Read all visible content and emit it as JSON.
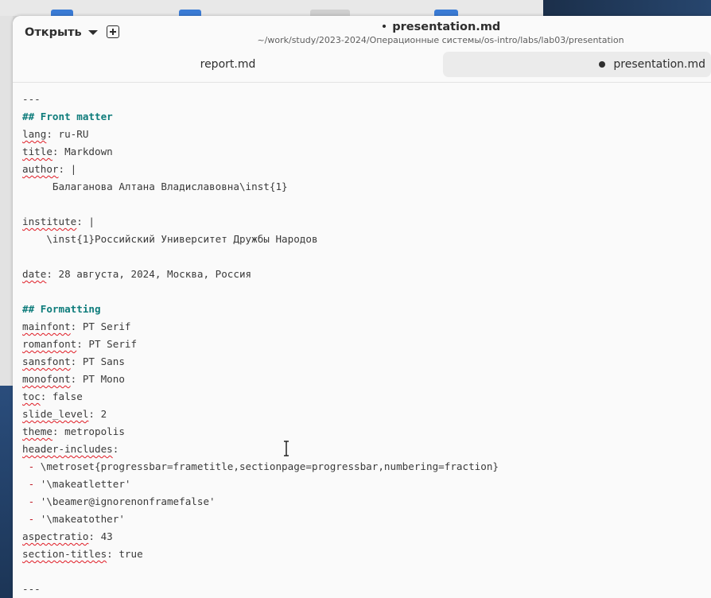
{
  "window": {
    "title": "presentation.md",
    "modified_marker": "•",
    "subtitle": "~/work/study/2023-2024/Операционные системы/os-intro/labs/lab03/presentation"
  },
  "headerbar": {
    "open_label": "Открыть"
  },
  "tabs": [
    {
      "label": "report.md",
      "active": false,
      "modified": false
    },
    {
      "label": "presentation.md",
      "active": true,
      "modified": true
    }
  ],
  "editor": {
    "lines": [
      "---",
      "## Front matter",
      "lang: ru-RU",
      "title: Markdown",
      "author: |",
      "     Балаганова Алтана Владиславовна\\inst{1}",
      "",
      "institute: |",
      "    \\inst{1}Российский Университет Дружбы Народов",
      "",
      "date: 28 августа, 2024, Москва, Россия",
      "",
      "## Formatting",
      "mainfont: PT Serif",
      "romanfont: PT Serif",
      "sansfont: PT Sans",
      "monofont: PT Mono",
      "toc: false",
      "slide_level: 2",
      "theme: metropolis",
      "header-includes:",
      " - \\metroset{progressbar=frametitle,sectionpage=progressbar,numbering=fraction}",
      " - '\\makeatletter'",
      " - '\\beamer@ignorenonframefalse'",
      " - '\\makeatother'",
      "aspectratio: 43",
      "section-titles: true",
      "",
      "---"
    ]
  },
  "colors": {
    "heading": "#0e7c7b",
    "bullet": "#c01c28",
    "spell_underline": "#e01b24",
    "text": "#3a3a3a"
  }
}
